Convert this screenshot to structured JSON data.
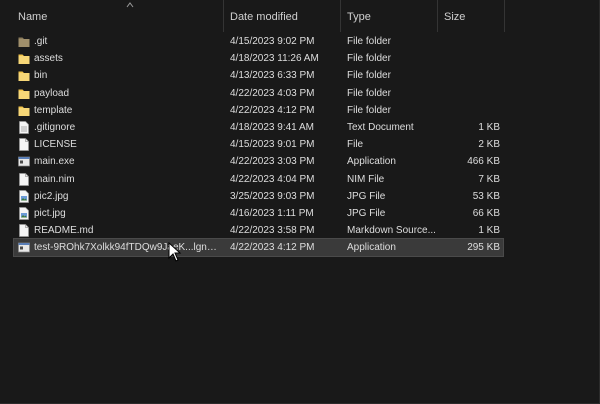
{
  "columns": {
    "name": "Name",
    "date_modified": "Date modified",
    "type": "Type",
    "size": "Size"
  },
  "files": [
    {
      "name": ".git",
      "date": "4/15/2023 9:02 PM",
      "type": "File folder",
      "size": "",
      "icon": "folder-dark-icon"
    },
    {
      "name": "assets",
      "date": "4/18/2023 11:26 AM",
      "type": "File folder",
      "size": "",
      "icon": "folder-icon"
    },
    {
      "name": "bin",
      "date": "4/13/2023 6:33 PM",
      "type": "File folder",
      "size": "",
      "icon": "folder-icon"
    },
    {
      "name": "payload",
      "date": "4/22/2023 4:03 PM",
      "type": "File folder",
      "size": "",
      "icon": "folder-icon"
    },
    {
      "name": "template",
      "date": "4/22/2023 4:12 PM",
      "type": "File folder",
      "size": "",
      "icon": "folder-icon"
    },
    {
      "name": ".gitignore",
      "date": "4/18/2023 9:41 AM",
      "type": "Text Document",
      "size": "1 KB",
      "icon": "text-file-icon"
    },
    {
      "name": "LICENSE",
      "date": "4/15/2023 9:01 PM",
      "type": "File",
      "size": "2 KB",
      "icon": "blank-file-icon"
    },
    {
      "name": "main.exe",
      "date": "4/22/2023 3:03 PM",
      "type": "Application",
      "size": "466 KB",
      "icon": "application-icon"
    },
    {
      "name": "main.nim",
      "date": "4/22/2023 4:04 PM",
      "type": "NIM File",
      "size": "7 KB",
      "icon": "blank-file-icon"
    },
    {
      "name": "pic2.jpg",
      "date": "3/25/2023 9:03 PM",
      "type": "JPG File",
      "size": "53 KB",
      "icon": "image-file-icon"
    },
    {
      "name": "pict.jpg",
      "date": "4/16/2023 1:11 PM",
      "type": "JPG File",
      "size": "66 KB",
      "icon": "image-file-icon"
    },
    {
      "name": "README.md",
      "date": "4/22/2023 3:58 PM",
      "type": "Markdown Source...",
      "size": "1 KB",
      "icon": "blank-file-icon"
    },
    {
      "name": "test-9ROhk7Xolkk94fTDQw9JaeK...lgnn.jpg...",
      "date": "4/22/2023 4:12 PM",
      "type": "Application",
      "size": "295 KB",
      "icon": "application-icon",
      "selected": true
    }
  ],
  "colors": {
    "background": "#191919",
    "folder": "#f3c54a",
    "folder_dark": "#8a7a5a",
    "selection": "#3a3a3a"
  }
}
